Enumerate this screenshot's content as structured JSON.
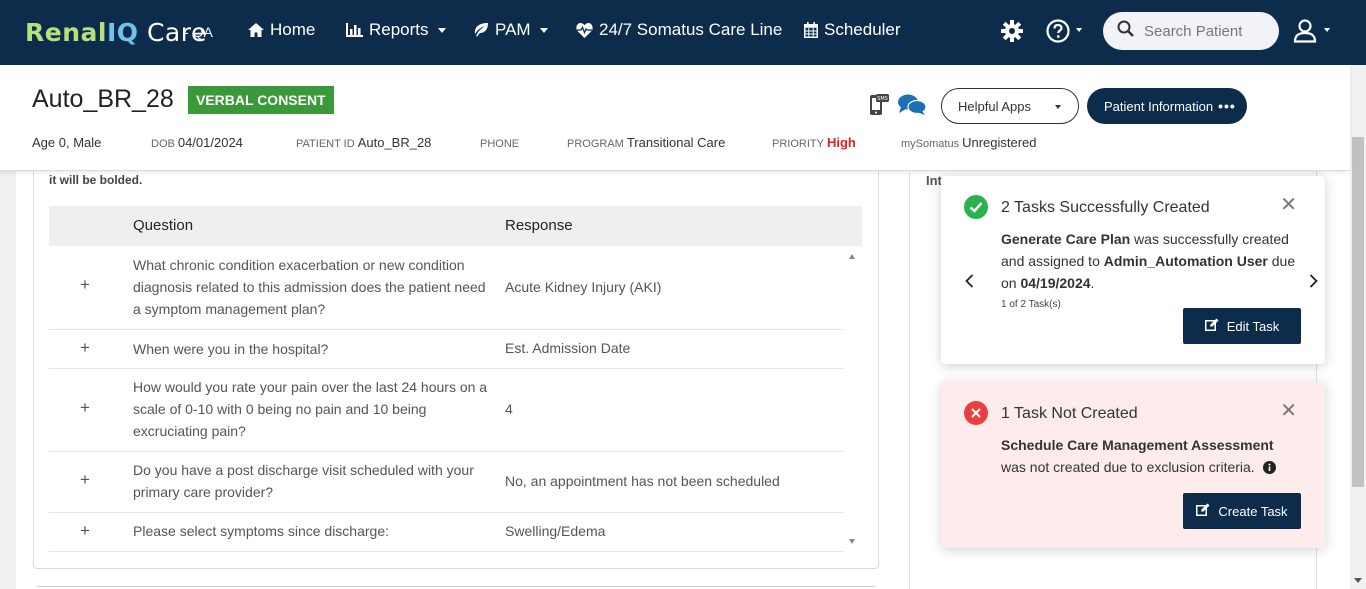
{
  "brand": {
    "renal": "Renal",
    "iq": "IQ",
    "care": " Care",
    "env": "- QA"
  },
  "nav": {
    "home": "Home",
    "reports": "Reports",
    "pam": "PAM",
    "careline": "24/7 Somatus Care Line",
    "scheduler": "Scheduler"
  },
  "search": {
    "placeholder": "Search Patient"
  },
  "patient": {
    "name": "Auto_BR_28",
    "consent": "VERBAL CONSENT",
    "helpful_apps": "Helpful Apps",
    "patient_info": "Patient Information",
    "patient_info_dots": "•••",
    "age_sex": "Age 0, Male",
    "dob_label": "DOB",
    "dob": "04/01/2024",
    "id_label": "PATIENT ID",
    "id": "Auto_BR_28",
    "phone_label": "PHONE",
    "phone": "",
    "program_label": "PROGRAM",
    "program": "Transitional Care",
    "priority_label": "PRIORITY",
    "priority": "High",
    "mysomatus_label": "mySomatus",
    "mysomatus": "Unregistered"
  },
  "assessment": {
    "note": "it will be bolded.",
    "col_question": "Question",
    "col_response": "Response",
    "rows": [
      {
        "question": "What chronic condition exacerbation or new condition diagnosis related to this admission does the patient need a symptom management plan?",
        "response": "Acute Kidney Injury (AKI)"
      },
      {
        "question": "When were you in the hospital?",
        "response": "Est. Admission Date"
      },
      {
        "question": "How would you rate your pain over the last 24 hours on a scale of 0-10 with 0 being no pain and 10 being excruciating pain?",
        "response": "4"
      },
      {
        "question": "Do you have a post discharge visit scheduled with your primary care provider?",
        "response": "No, an appointment has not been scheduled"
      },
      {
        "question": "Please select symptoms since discharge:",
        "response": "Swelling/Edema"
      }
    ]
  },
  "side": {
    "label": "Int"
  },
  "toast_success": {
    "title": "2 Tasks Successfully Created",
    "task": "Generate Care Plan",
    "text1": " was successfully created and assigned to ",
    "user": "Admin_Automation User",
    "text2": " due on ",
    "date": "04/19/2024",
    "text3": ".",
    "count": "1 of 2 Task(s)",
    "button": "Edit Task"
  },
  "toast_error": {
    "title": "1 Task Not Created",
    "task": "Schedule Care Management Assessment",
    "text": " was not created due to exclusion criteria.",
    "button": "Create Task"
  },
  "colors": {
    "navy": "#0d2c4b",
    "consent_green": "#3a9a3a",
    "priority_red": "#e02020",
    "success_green": "#2bb24c",
    "error_red": "#e84040"
  }
}
